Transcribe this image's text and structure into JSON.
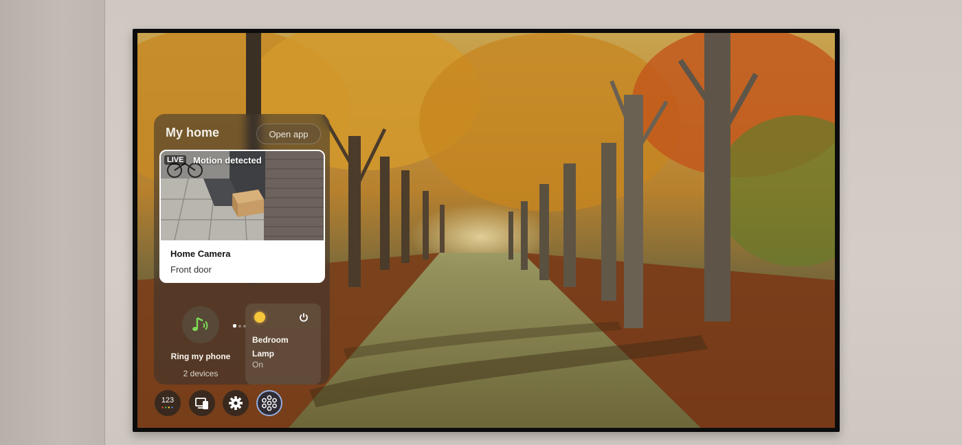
{
  "panel": {
    "title": "My home",
    "open_app_label": "Open app"
  },
  "camera_card": {
    "live_badge": "LIVE",
    "status": "Motion detected",
    "name": "Home Camera",
    "location": "Front door",
    "pager_total": 3,
    "pager_active": 1
  },
  "ring_tile": {
    "label": "Ring my phone",
    "subtitle": "2 devices",
    "icon": "music-note-icon"
  },
  "lamp_tile": {
    "label_line1": "Bedroom",
    "label_line2": "Lamp",
    "state": "On",
    "icon": "lightbulb-icon",
    "accent": "#f5c63a"
  },
  "dock": {
    "numpad_label": "123",
    "items": [
      "numpad-icon",
      "devices-icon",
      "gear-icon",
      "smart-home-icon"
    ]
  },
  "colors": {
    "ring_icon": "#7ed957",
    "dock_active_ring": "#aac8ff"
  }
}
